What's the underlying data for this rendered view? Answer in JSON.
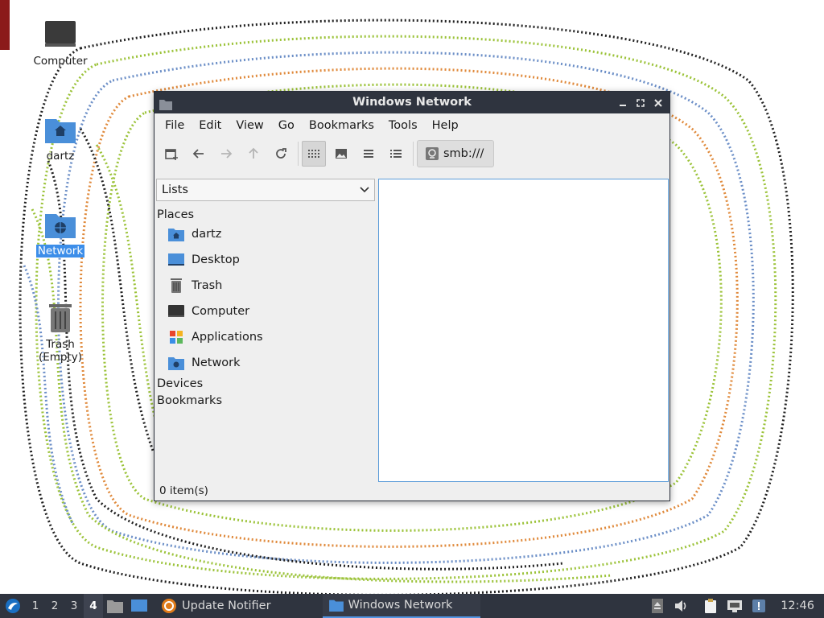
{
  "desktop": {
    "icons": [
      {
        "label": "Computer"
      },
      {
        "label": "dartz"
      },
      {
        "label": "Network"
      },
      {
        "label": "Trash (Empty)"
      }
    ]
  },
  "window": {
    "title": "Windows Network",
    "menu": [
      "File",
      "Edit",
      "View",
      "Go",
      "Bookmarks",
      "Tools",
      "Help"
    ],
    "path": "smb:///",
    "side_mode": "Lists",
    "sections": {
      "places": "Places",
      "devices": "Devices",
      "bookmarks": "Bookmarks"
    },
    "places": [
      {
        "label": "dartz",
        "icon": "home-folder-icon"
      },
      {
        "label": "Desktop",
        "icon": "desktop-icon"
      },
      {
        "label": "Trash",
        "icon": "trash-icon"
      },
      {
        "label": "Computer",
        "icon": "computer-icon"
      },
      {
        "label": "Applications",
        "icon": "applications-icon"
      },
      {
        "label": "Network",
        "icon": "network-folder-icon"
      }
    ],
    "status": "0 item(s)"
  },
  "taskbar": {
    "workspaces": [
      "1",
      "2",
      "3",
      "4"
    ],
    "active_workspace": "4",
    "tasks": [
      {
        "label": "Update Notifier"
      },
      {
        "label": "Windows Network"
      }
    ],
    "clock": "12:46"
  },
  "colors": {
    "accent": "#5294e2",
    "titlebar": "#2f343f",
    "folder_blue": "#4a8fd9"
  }
}
